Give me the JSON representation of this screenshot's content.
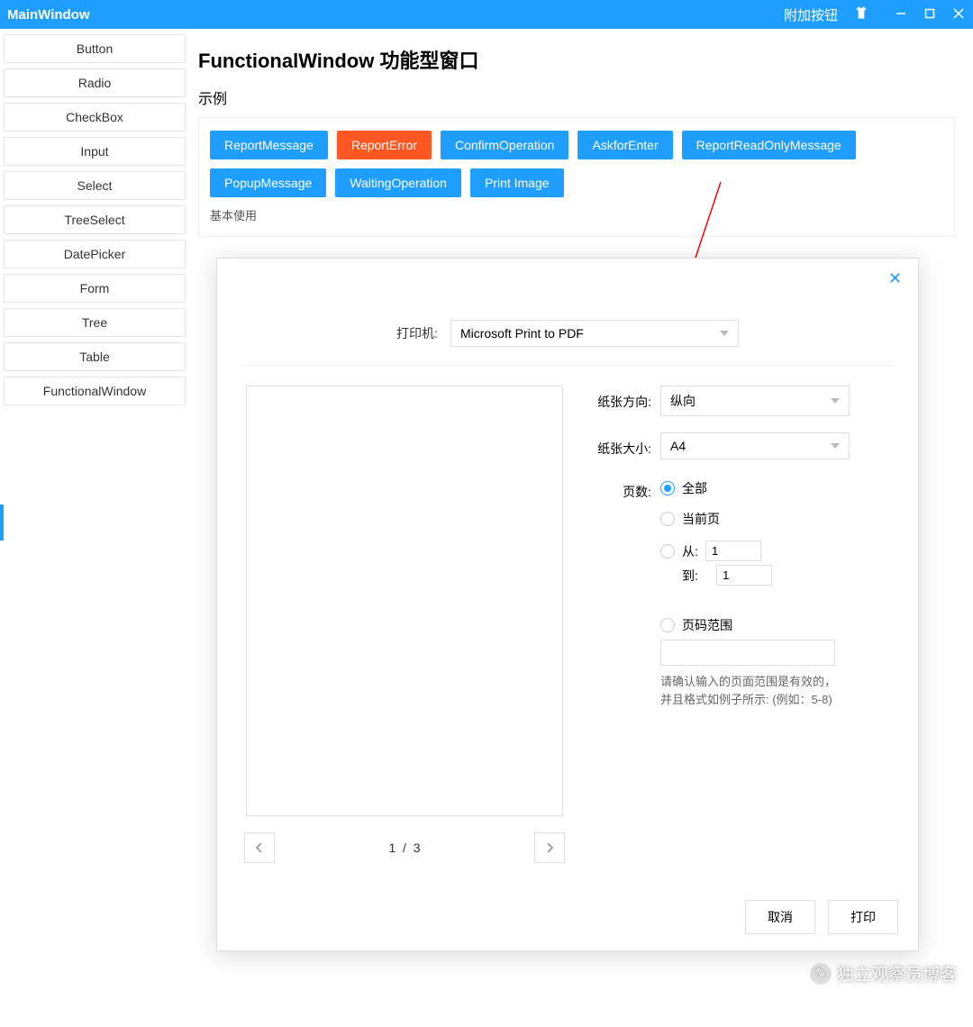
{
  "titlebar": {
    "title": "MainWindow",
    "extra_button": "附加按钮"
  },
  "sidebar": {
    "items": [
      "Button",
      "Radio",
      "CheckBox",
      "Input",
      "Select",
      "TreeSelect",
      "DatePicker",
      "Form",
      "Tree",
      "Table",
      "FunctionalWindow"
    ]
  },
  "page": {
    "title": "FunctionalWindow 功能型窗口",
    "example_label": "示例",
    "buttons": [
      "ReportMessage",
      "ReportError",
      "ConfirmOperation",
      "AskforEnter",
      "ReportReadOnlyMessage",
      "PopupMessage",
      "WaitingOperation",
      "Print Image"
    ],
    "basic_usage": "基本使用"
  },
  "dialog": {
    "printer_label": "打印机:",
    "printer_value": "Microsoft Print to PDF",
    "orientation_label": "纸张方向:",
    "orientation_value": "纵向",
    "size_label": "纸张大小:",
    "size_value": "A4",
    "pages_label": "页数:",
    "radio_all": "全部",
    "radio_current": "当前页",
    "radio_from": "从:",
    "radio_to": "到:",
    "from_value": "1",
    "to_value": "1",
    "radio_range": "页码范围",
    "range_hint": "请确认输入的页面范围是有效的，并且格式如例子所示:\n(例如：5-8)",
    "pager_current": "1",
    "pager_sep": "/",
    "pager_total": "3",
    "cancel": "取消",
    "print": "打印"
  },
  "watermark": "独立观察员博客"
}
